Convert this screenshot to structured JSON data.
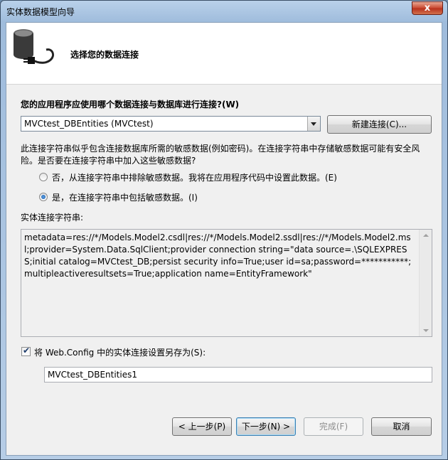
{
  "window": {
    "title": "实体数据模型向导",
    "close_glyph": "x"
  },
  "header": {
    "title": "选择您的数据连接",
    "icon": "database-plug-icon"
  },
  "connection": {
    "question": "您的应用程序应使用哪个数据连接与数据库进行连接?(W)",
    "selected": "MVCtest_DBEntities (MVCtest)",
    "new_connection_label": "新建连接(C)..."
  },
  "sensitive": {
    "warning": "此连接字符串似乎包含连接数据库所需的敏感数据(例如密码)。在连接字符串中存储敏感数据可能有安全风险。是否要在连接字符串中加入这些敏感数据?",
    "option_exclude": "否，从连接字符串中排除敏感数据。我将在应用程序代码中设置此数据。(E)",
    "option_include": "是，在连接字符串中包括敏感数据。(I)",
    "selected": "include"
  },
  "entity_string": {
    "label": "实体连接字符串:",
    "value": "metadata=res://*/Models.Model2.csdl|res://*/Models.Model2.ssdl|res://*/Models.Model2.msl;provider=System.Data.SqlClient;provider connection string=\"data source=.\\SQLEXPRESS;initial catalog=MVCtest_DB;persist security info=True;user id=sa;password=***********;multipleactiveresultsets=True;application name=EntityFramework\""
  },
  "save_config": {
    "checked": true,
    "check_glyph": "✔",
    "label": "将 Web.Config 中的实体连接设置另存为(S):",
    "value": "MVCtest_DBEntities1"
  },
  "buttons": {
    "back": "< 上一步(P)",
    "next": "下一步(N) >",
    "finish": "完成(F)",
    "cancel": "取消"
  }
}
